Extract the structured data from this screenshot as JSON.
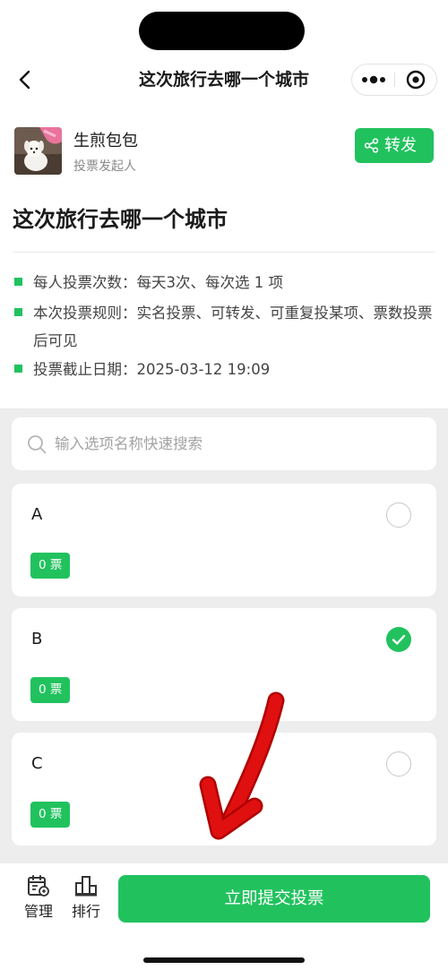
{
  "nav": {
    "title": "这次旅行去哪一个城市",
    "back_icon": "chevron-left-icon",
    "more_icon": "more-dots-icon",
    "close_icon": "target-circle-icon"
  },
  "author": {
    "name": "生煎包包",
    "role": "投票发起人",
    "avatar": "dog-photo-avatar"
  },
  "share": {
    "label": "转发",
    "icon": "share-nodes-icon"
  },
  "poll": {
    "title": "这次旅行去哪一个城市",
    "rules": [
      {
        "text": "每人投票次数：每天3次、每次选 1 项"
      },
      {
        "text": "本次投票规则：实名投票、可转发、可重复投某项、票数投票后可见"
      },
      {
        "text": "投票截止日期：2025-03-12 19:09"
      }
    ]
  },
  "search": {
    "placeholder": "输入选项名称快速搜索",
    "value": ""
  },
  "options": [
    {
      "label": "A",
      "votes": "0 票",
      "selected": false
    },
    {
      "label": "B",
      "votes": "0 票",
      "selected": true
    },
    {
      "label": "C",
      "votes": "0 票",
      "selected": false
    }
  ],
  "toolbar": {
    "manage_label": "管理",
    "manage_icon": "calendar-gear-icon",
    "rank_label": "排行",
    "rank_icon": "podium-icon",
    "submit_label": "立即提交投票"
  },
  "colors": {
    "accent": "#21c25e",
    "annotation": "#e01010",
    "background": "#ededed"
  }
}
